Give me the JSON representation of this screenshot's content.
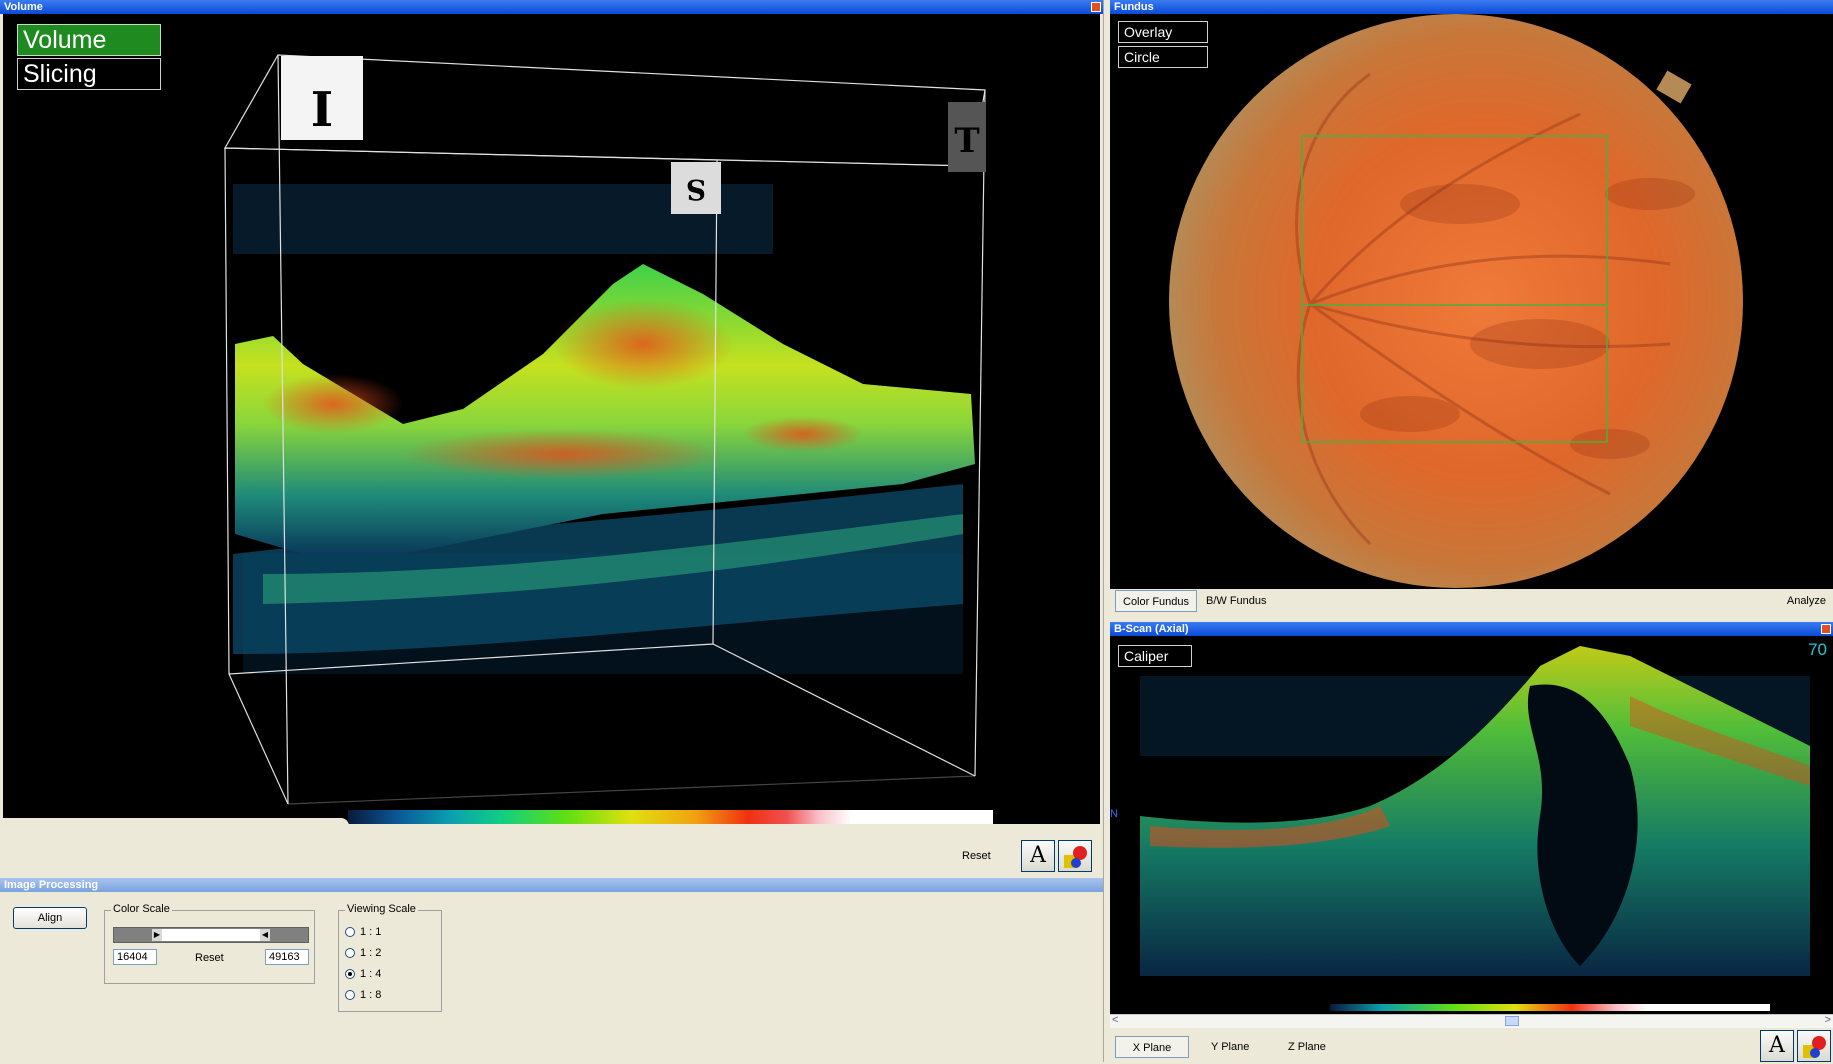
{
  "volume": {
    "title": "Volume",
    "mode_buttons": [
      "Volume",
      "Slicing"
    ],
    "markers": [
      "I",
      "S",
      "T"
    ],
    "reset_label": "Reset",
    "text_tool_glyph": "A"
  },
  "fundus": {
    "title": "Fundus",
    "overlay_buttons": [
      "Overlay",
      "Circle"
    ],
    "tabs": [
      "Color Fundus",
      "B/W Fundus"
    ],
    "analyze_label": "Analyze"
  },
  "bscan": {
    "title": "B-Scan (Axial)",
    "caliper_label": "Caliper",
    "slice_number": "70",
    "side_label": "N",
    "tabs": [
      "X Plane",
      "Y Plane",
      "Z Plane"
    ],
    "text_tool_glyph": "A"
  },
  "image_processing": {
    "title": "Image Processing",
    "align_label": "Align",
    "color_scale": {
      "legend": "Color Scale",
      "min_value": "16404",
      "max_value": "49163",
      "reset_label": "Reset"
    },
    "viewing_scale": {
      "legend": "Viewing Scale",
      "options": [
        "1 : 1",
        "1 : 2",
        "1 : 4",
        "1 : 8"
      ],
      "selected": "1 : 4"
    }
  },
  "colors": {
    "titlebar": "#0a4bd8",
    "active_mode": "#1f8a1f",
    "roi": "#4caf3f"
  },
  "icons": [
    "text-tool-icon",
    "color-tool-icon",
    "close-icon",
    "scroll-left-icon",
    "scroll-right-icon"
  ]
}
